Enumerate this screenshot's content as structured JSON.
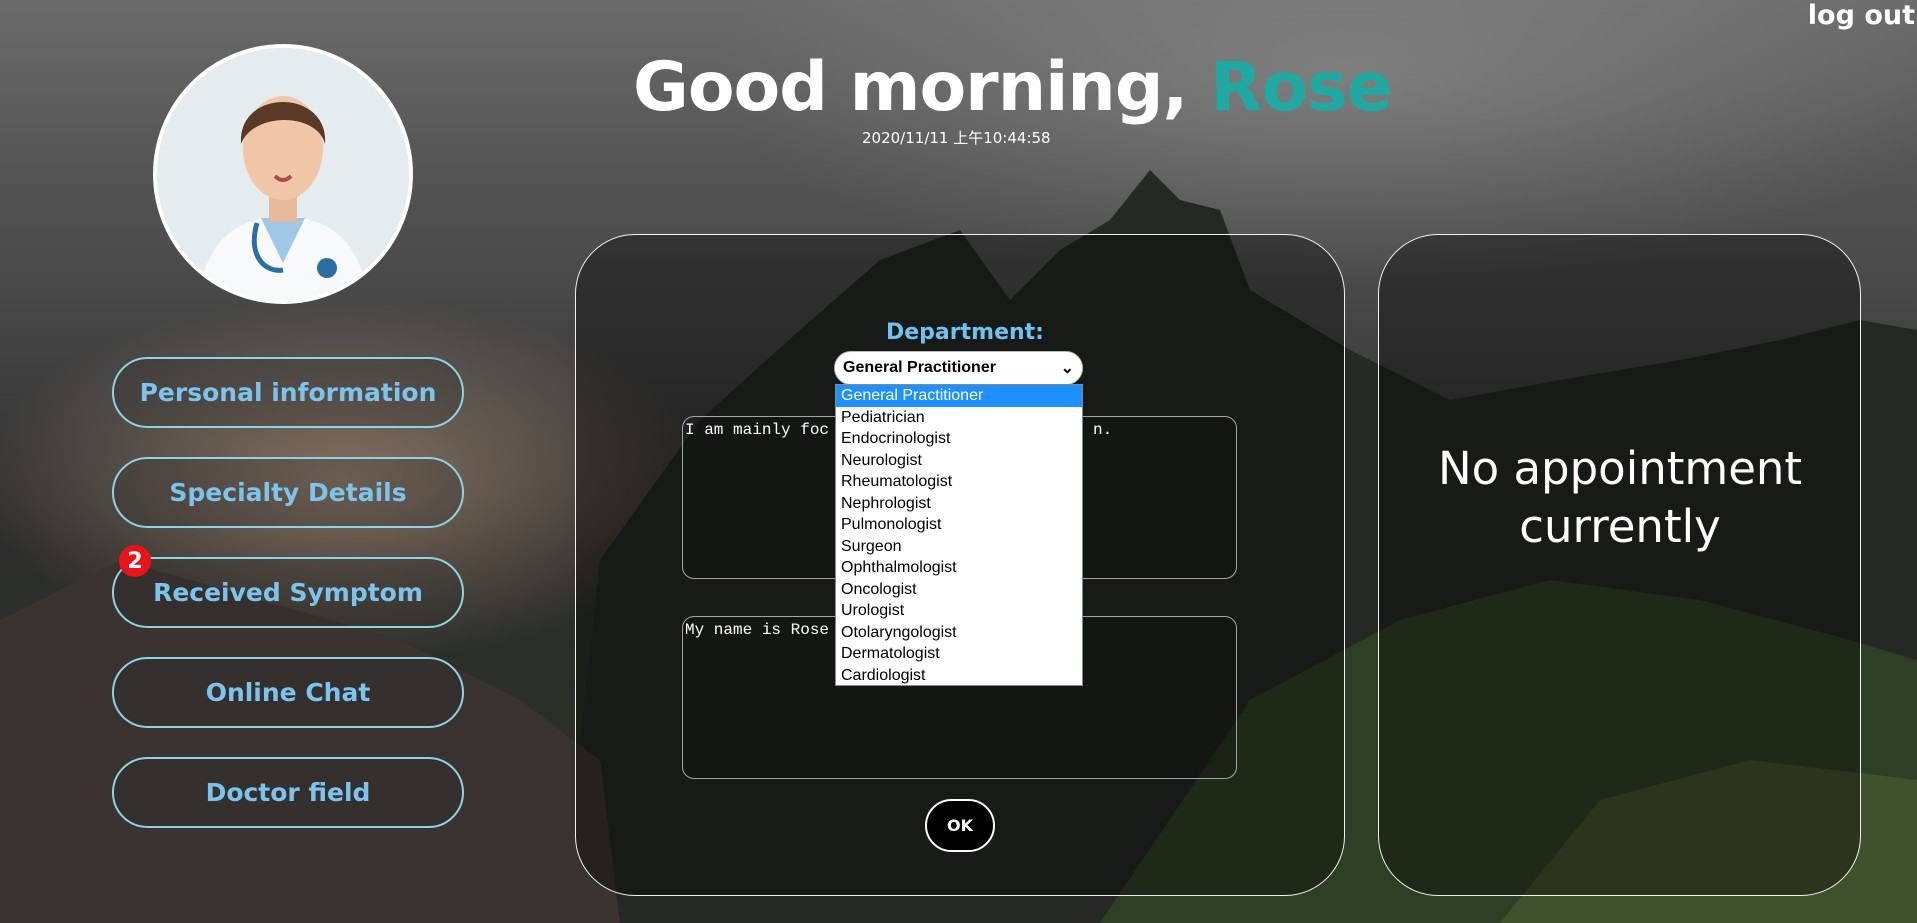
{
  "header": {
    "greeting_prefix": "Good morning, ",
    "user_name": "Rose",
    "datetime": "2020/11/11 上午10:44:58",
    "logout_label": "log out"
  },
  "sidebar": {
    "items": [
      {
        "label": "Personal information"
      },
      {
        "label": "Specialty Details"
      },
      {
        "label": "Received Symptom",
        "badge": "2"
      },
      {
        "label": "Online Chat"
      },
      {
        "label": "Doctor field"
      }
    ]
  },
  "form": {
    "department_label": "Department:",
    "selected_department": "General Practitioner",
    "options": [
      "General Practitioner",
      "Pediatrician",
      "Endocrinologist",
      "Neurologist",
      "Rheumatologist",
      "Nephrologist",
      "Pulmonologist",
      "Surgeon",
      "Ophthalmologist",
      "Oncologist",
      "Urologist",
      "Otolaryngologist",
      "Dermatologist",
      "Cardiologist"
    ],
    "textarea1_value": "I am mainly foc",
    "textarea1_tail": "n.",
    "textarea2_value": "My name is Rose",
    "ok_label": "OK"
  },
  "appointments": {
    "empty_text_line1": "No appointment",
    "empty_text_line2": "currently"
  },
  "colors": {
    "accent_teal": "#1fa9a2",
    "menu_text": "#7cc4ee",
    "badge_red": "#e8141a",
    "selected_option": "#1e90ff"
  }
}
